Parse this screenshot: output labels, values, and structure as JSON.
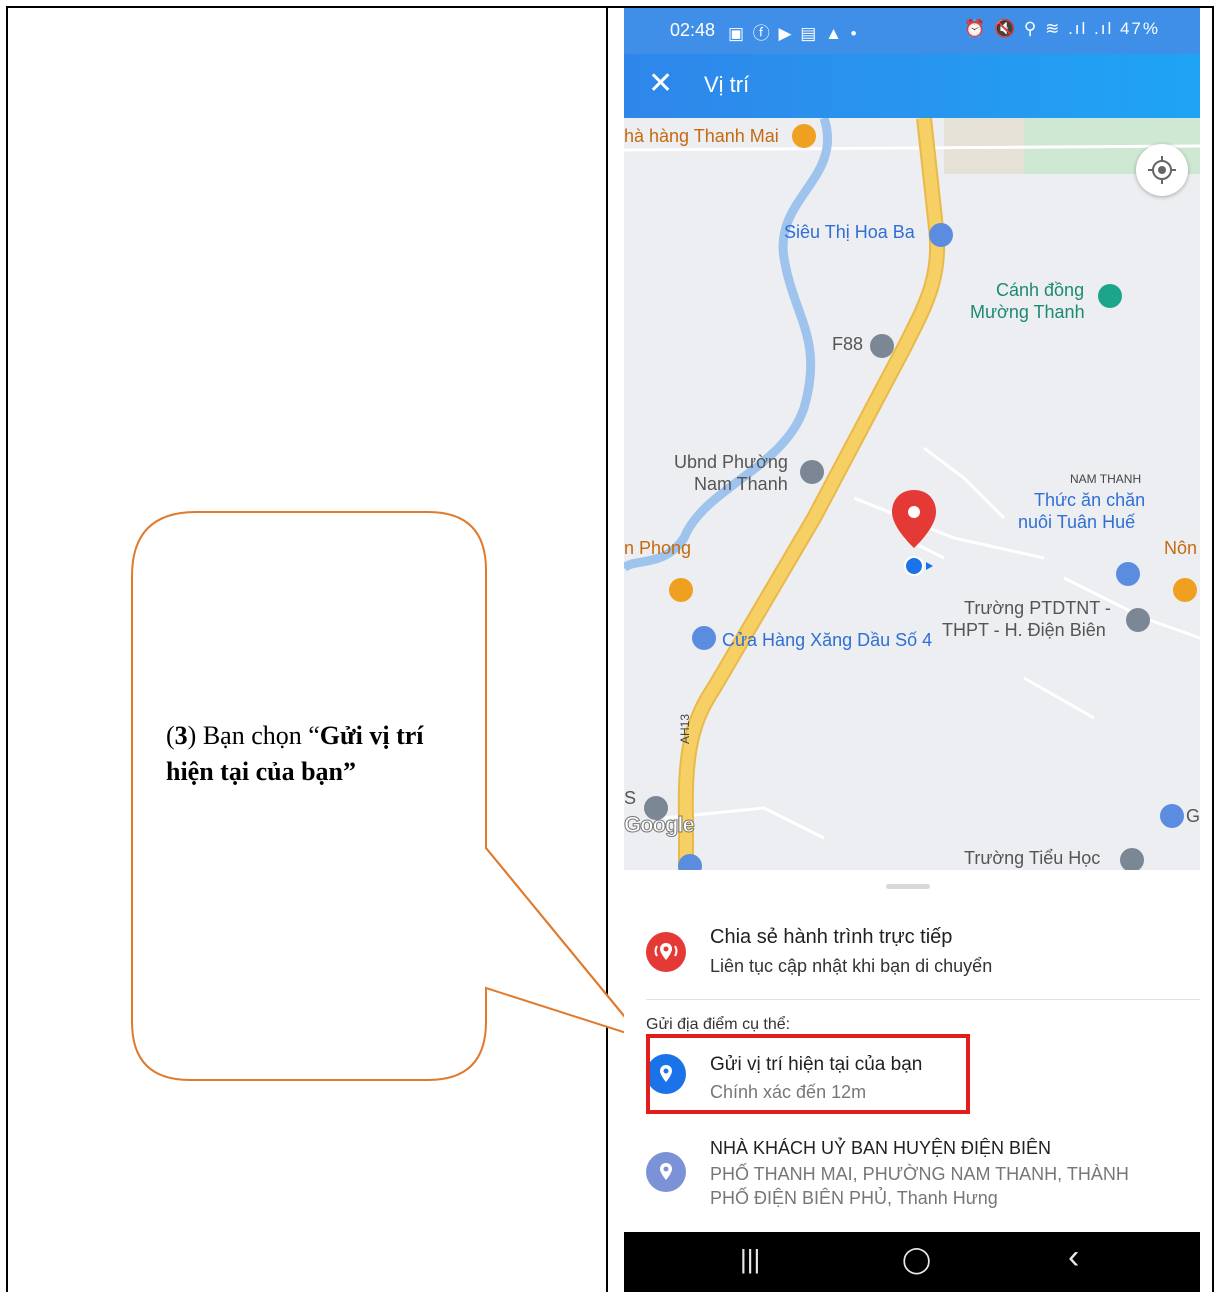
{
  "callout": {
    "prefix": "(",
    "step": "3",
    "middle": ") Bạn chọn “",
    "bold_text": "Gửi vị trí hiện tại của bạn”"
  },
  "status_bar": {
    "time": "02:48",
    "left_icons": "▣ ⓕ ▶ ▤ ▲ •",
    "right_icons": "⏰ 🔇 ⚲ ≋ .ıl .ıl",
    "battery": "47%"
  },
  "app_bar": {
    "close_symbol": "✕",
    "title": "Vị trí"
  },
  "map": {
    "labels": {
      "thanh_mai": "hà hàng Thanh Mai",
      "sieu_thi": "Siêu Thị Hoa Ba",
      "canh_dong_1": "Cánh đồng",
      "canh_dong_2": "Mường Thanh",
      "f88": "F88",
      "ubnd_1": "Ubnd Phường",
      "ubnd_2": "Nam Thanh",
      "nam_thanh": "NAM THANH",
      "thuc_an_1": "Thức ăn chăn",
      "thuc_an_2": "nuôi Tuân Huế",
      "phong": "n Phong",
      "non": "Nôn",
      "truong_1": "Trường PTDTNT -",
      "truong_2": "THPT - H. Điện Biên",
      "cua_hang": "Cửa Hàng Xăng Dầu Số 4",
      "ah13": "AH13",
      "s_label": "S",
      "g_label": "G",
      "tieu_hoc": "Trường Tiểu Học",
      "google": "Google"
    }
  },
  "sheet": {
    "live": {
      "title": "Chia sẻ hành trình trực tiếp",
      "subtitle": "Liên tục cập nhật khi bạn di chuyển"
    },
    "section_label": "Gửi địa điểm cụ thể:",
    "current": {
      "title": "Gửi vị trí hiện tại của bạn",
      "subtitle": "Chính xác đến 12m"
    },
    "place": {
      "title": "NHÀ KHÁCH UỶ BAN HUYỆN ĐIỆN BIÊN",
      "address_1": "PHỐ THANH MAI, PHƯỜNG NAM THANH, THÀNH",
      "address_2": "PHỐ ĐIỆN BIÊN PHỦ, Thanh Hưng"
    }
  },
  "nav_bar": {
    "recents": "|||",
    "home": "◯",
    "back": "‹"
  },
  "colors": {
    "app_bar": "#2f86ea",
    "highlight": "#e21d1d",
    "callout_stroke": "#e07b2e",
    "pin_red": "#e53935",
    "pin_blue": "#1a73e8",
    "road": "#f6cf65"
  }
}
